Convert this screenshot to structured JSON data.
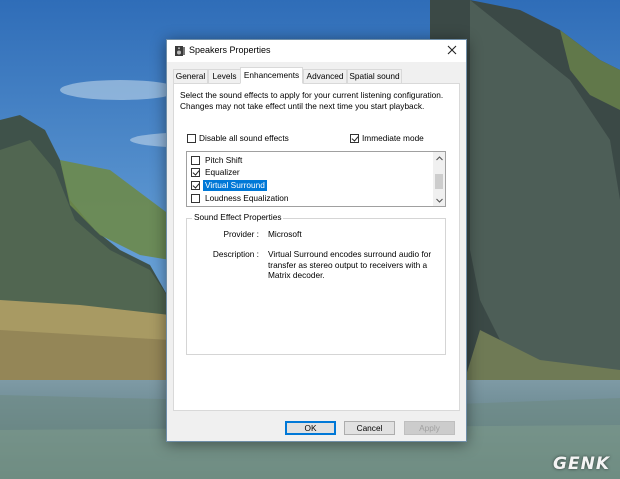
{
  "window": {
    "title": "Speakers Properties",
    "close_icon": "close-icon",
    "title_icon": "speaker-icon"
  },
  "tabs": [
    {
      "label": "General",
      "active": false
    },
    {
      "label": "Levels",
      "active": false
    },
    {
      "label": "Enhancements",
      "active": true
    },
    {
      "label": "Advanced",
      "active": false
    },
    {
      "label": "Spatial sound",
      "active": false
    }
  ],
  "enhancements": {
    "intro": "Select the sound effects to apply for your current listening configuration. Changes may not take effect until the next time you start playback.",
    "disable_all": {
      "label": "Disable all sound effects",
      "checked": false
    },
    "immediate_mode": {
      "label": "Immediate mode",
      "checked": true
    },
    "effects": [
      {
        "label": "Pitch Shift",
        "checked": false,
        "selected": false
      },
      {
        "label": "Equalizer",
        "checked": true,
        "selected": false
      },
      {
        "label": "Virtual Surround",
        "checked": true,
        "selected": true
      },
      {
        "label": "Loudness Equalization",
        "checked": false,
        "selected": false
      }
    ],
    "properties": {
      "legend": "Sound Effect Properties",
      "provider_label": "Provider :",
      "provider_value": "Microsoft",
      "description_label": "Description :",
      "description_value": "Virtual Surround encodes surround audio for transfer as stereo output to receivers with a Matrix decoder."
    }
  },
  "buttons": {
    "ok": "OK",
    "cancel": "Cancel",
    "apply": "Apply"
  },
  "watermark": "GENK",
  "colors": {
    "selection": "#0078d7",
    "sky": "#3f7fc4",
    "rock": "#4a5a56"
  }
}
